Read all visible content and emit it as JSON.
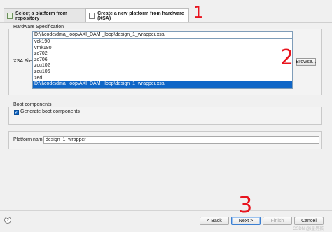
{
  "tabs": [
    {
      "label": "Select a platform from repository"
    },
    {
      "label": "Create a new platform from hardware (XSA)"
    }
  ],
  "hardware": {
    "section_title": "Hardware Specification",
    "xsa_label": "XSA File:",
    "xsa_value": "D:\\jl\\code\\dma_loop\\AXI_DAM _loop\\design_1_wrapper.xsa",
    "browse_label": "Browse...",
    "dropdown_items": [
      "vck190",
      "vmk180",
      "zc702",
      "zc706",
      "zcu102",
      "zcu106",
      "zed",
      "D:\\jl\\code\\dma_loop\\AXI_DAM _loop\\design_1_wrapper.xsa"
    ],
    "selected_index": 7
  },
  "boot": {
    "section_title": "Boot components",
    "checkbox_label": "Generate boot components",
    "checked": true
  },
  "platform": {
    "name_label": "Platform name:",
    "name_value": "design_1_wrapper"
  },
  "footer": {
    "help_glyph": "?",
    "back": "< Back",
    "next": "Next >",
    "finish": "Finish",
    "cancel": "Cancel"
  },
  "annotations": [
    "1",
    "2",
    "3"
  ],
  "watermark": "CSDN @i皇男孩",
  "colors": {
    "selection": "#0f66c7",
    "annotation": "#e8141e"
  }
}
